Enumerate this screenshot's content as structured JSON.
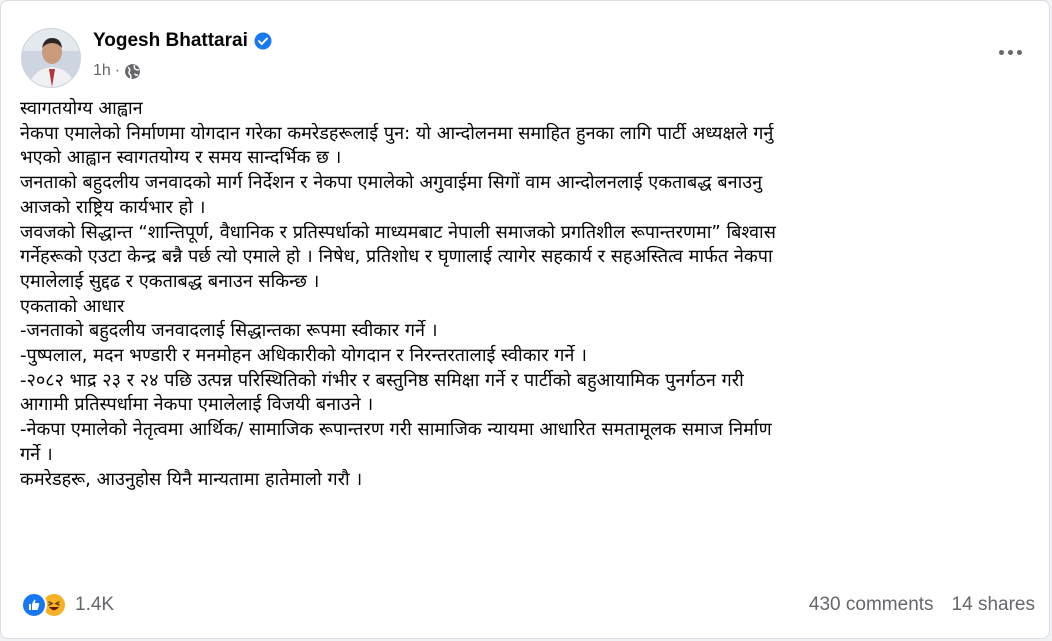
{
  "post": {
    "author": "Yogesh Bhattarai",
    "time": "1h",
    "separator": "·",
    "lines": [
      "स्वागतयोग्य आह्वान",
      "नेकपा एमालेको निर्माणमा योगदान गरेका कमरेडहरूलाई पुन: यो आन्दोलनमा समाहित हुनका लागि पार्टी अध्यक्षले गर्नु",
      "भएको आह्वान स्वागतयोग्य र समय सान्दर्भिक छ ।",
      "जनताको बहुदलीय जनवादको मार्ग निर्देशन र नेकपा एमालेको अगुवाईमा सिगों वाम आन्दोलनलाई एकताबद्ध बनाउनु",
      "आजको राष्ट्रिय कार्यभार हो ।",
      "जवजको सिद्धान्त “शान्तिपूर्ण, वैधानिक र प्रतिस्पर्धाको माध्यमबाट नेपाली समाजको प्रगतिशील रूपान्तरणमा” बिश्वास",
      "गर्नेहरूको एउटा केन्द्र बन्नै पर्छ त्यो एमाले हो । निषेध, प्रतिशोध र घृणालाई त्यागेर सहकार्य र सहअस्तित्व मार्फत नेकपा",
      "एमालेलाई सुद्दढ र एकताबद्ध बनाउन सकिन्छ ।",
      "एकताको आधार",
      "-जनताको बहुदलीय जनवादलाई सिद्धान्तका रूपमा स्वीकार गर्ने ।",
      "-पुष्पलाल, मदन भण्डारी र मनमोहन अधिकारीको योगदान र निरन्तरतालाई स्वीकार गर्ने ।",
      "-२०८२ भाद्र २३ र २४ पछि उत्पन्न परिस्थितिको गंभीर र बस्तुनिष्ठ समिक्षा गर्ने र पार्टीको बहुआयामिक पुनर्गठन  गरी",
      "आगामी प्रतिस्पर्धामा नेकपा एमालेलाई विजयी बनाउने ।",
      "-नेकपा एमालेको नेतृत्वमा आर्थिक/ सामाजिक रूपान्तरण गरी सामाजिक न्यायमा आधारित समतामूलक समाज निर्माण",
      "गर्ने ।",
      "कमरेडहरू, आउनुहोस यिनै मान्यतामा हातेमालो गरौ ।"
    ],
    "reactions_count": "1.4K",
    "comments": "430 comments",
    "shares": "14 shares"
  },
  "icons": {
    "verified": "verified-badge-icon",
    "privacy": "globe-icon",
    "more": "more-options-icon",
    "reaction_1": "like-reaction-icon",
    "reaction_2": "haha-reaction-icon"
  },
  "colors": {
    "accent": "#1877f2",
    "secondary_text": "#65676b",
    "haha": "#f7b125"
  }
}
